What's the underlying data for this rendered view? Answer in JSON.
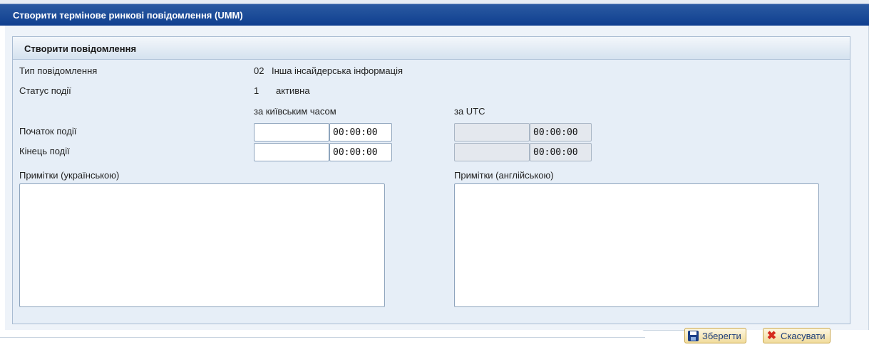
{
  "window": {
    "title": "Створити термінове ринкові повідомлення (UMM)"
  },
  "panel": {
    "title": "Створити повідомлення"
  },
  "form": {
    "message_type": {
      "label": "Тип повідомлення",
      "code": "02",
      "text": "Інша інсайдерська інформація"
    },
    "event_status": {
      "label": "Статус події",
      "code": "1",
      "text": "активна"
    },
    "kyiv_time_header": "за київським часом",
    "utc_header": "за UTC",
    "event_start": {
      "label": "Початок події",
      "kyiv_date": "",
      "kyiv_time": "00:00:00",
      "utc_date": "",
      "utc_time": "00:00:00"
    },
    "event_end": {
      "label": "Кінець події",
      "kyiv_date": "",
      "kyiv_time": "00:00:00",
      "utc_date": "",
      "utc_time": "00:00:00"
    },
    "notes_ua": {
      "label": "Примітки (українською)",
      "value": ""
    },
    "notes_en": {
      "label": "Примітки (англійською)",
      "value": ""
    }
  },
  "footer": {
    "save_button": {
      "label": "Зберегти",
      "icon": "save-icon"
    },
    "cancel_button": {
      "label": "Скасувати",
      "icon": "cancel-icon"
    }
  }
}
